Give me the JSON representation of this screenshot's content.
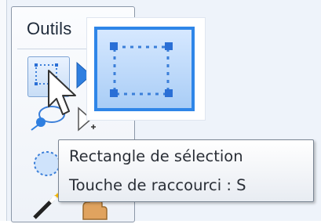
{
  "panel": {
    "title": "Outils"
  },
  "tools": [
    {
      "icon": "rectangle-select-icon",
      "selected": true
    },
    {
      "icon": "move-pixels-icon"
    },
    {
      "icon": "lasso-select-icon"
    },
    {
      "icon": "move-selection-icon"
    },
    {
      "icon": "ellipse-select-icon"
    },
    {
      "icon": "magic-wand-icon"
    },
    {
      "icon": "pan-hand-icon"
    }
  ],
  "magnifier": {
    "icon": "rectangle-select-icon"
  },
  "tooltip": {
    "line1": "Rectangle de sélection",
    "line2": "Touche de raccourci : S"
  },
  "colors": {
    "accent": "#2f86e8",
    "selection_dots": "#2a6fd6",
    "panel_border": "#8b97a8"
  }
}
